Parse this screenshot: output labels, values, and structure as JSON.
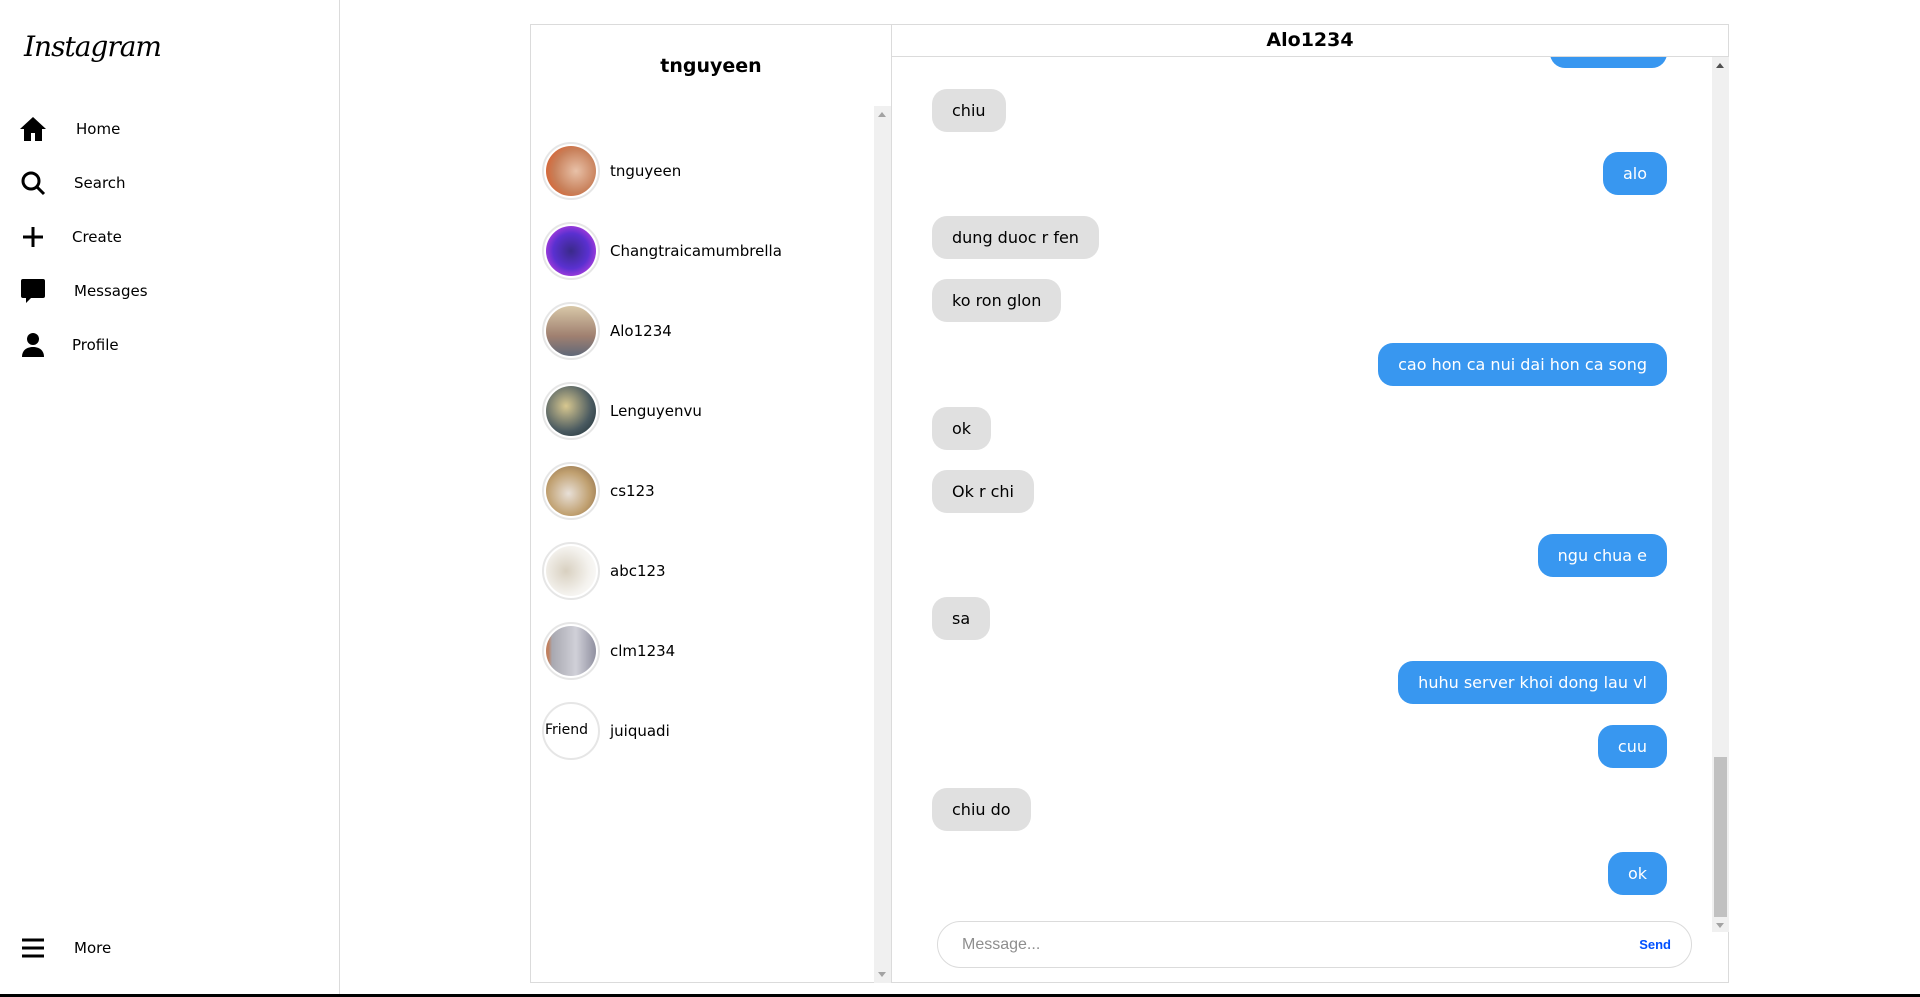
{
  "sidebar": {
    "logo": "Instagram",
    "items": [
      {
        "label": "Home",
        "icon": "home-icon"
      },
      {
        "label": "Search",
        "icon": "search-icon"
      },
      {
        "label": "Create",
        "icon": "plus-icon"
      },
      {
        "label": "Messages",
        "icon": "message-icon"
      },
      {
        "label": "Profile",
        "icon": "user-icon"
      }
    ],
    "more": "More"
  },
  "conversations": {
    "title": "tnguyeen",
    "items": [
      {
        "name": "tnguyeen"
      },
      {
        "name": "Changtraicamumbrella"
      },
      {
        "name": "Alo1234"
      },
      {
        "name": "Lenguyenvu"
      },
      {
        "name": "cs123"
      },
      {
        "name": "abc123"
      },
      {
        "name": "clm1234"
      },
      {
        "name": "juiquadi",
        "avatar_alt": "Friend"
      }
    ]
  },
  "chat": {
    "title": "Alo1234",
    "messages": [
      {
        "from": "me",
        "text": ""
      },
      {
        "from": "them",
        "text": "chiu"
      },
      {
        "from": "me",
        "text": "alo"
      },
      {
        "from": "them",
        "text": "dung duoc r fen"
      },
      {
        "from": "them",
        "text": "ko ron glon"
      },
      {
        "from": "me",
        "text": "cao hon ca nui dai hon ca song"
      },
      {
        "from": "them",
        "text": "ok"
      },
      {
        "from": "them",
        "text": "Ok r chi"
      },
      {
        "from": "me",
        "text": "ngu chua e"
      },
      {
        "from": "them",
        "text": "sa"
      },
      {
        "from": "me",
        "text": "huhu server khoi dong lau vl"
      },
      {
        "from": "me",
        "text": "cuu"
      },
      {
        "from": "them",
        "text": "chiu do"
      },
      {
        "from": "me",
        "text": "ok"
      }
    ],
    "input_placeholder": "Message...",
    "input_value": "",
    "send_label": "Send"
  },
  "colors": {
    "outgoing": "#3897f0",
    "incoming": "#e0e0e0",
    "send": "#0050ff"
  }
}
